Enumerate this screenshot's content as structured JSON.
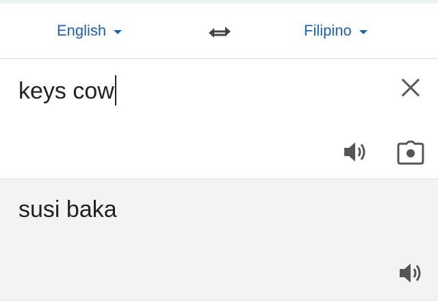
{
  "language_bar": {
    "source_language": "English",
    "target_language": "Filipino",
    "swap_icon": "swap-arrows-icon",
    "accent_color": "#1a5fb4"
  },
  "source": {
    "text": "keys cow",
    "clear_icon": "close-icon",
    "speaker_icon": "speaker-icon",
    "camera_icon": "camera-icon"
  },
  "result": {
    "text": "susi baka",
    "speaker_icon": "speaker-icon",
    "background_color": "#f1f3f4"
  }
}
